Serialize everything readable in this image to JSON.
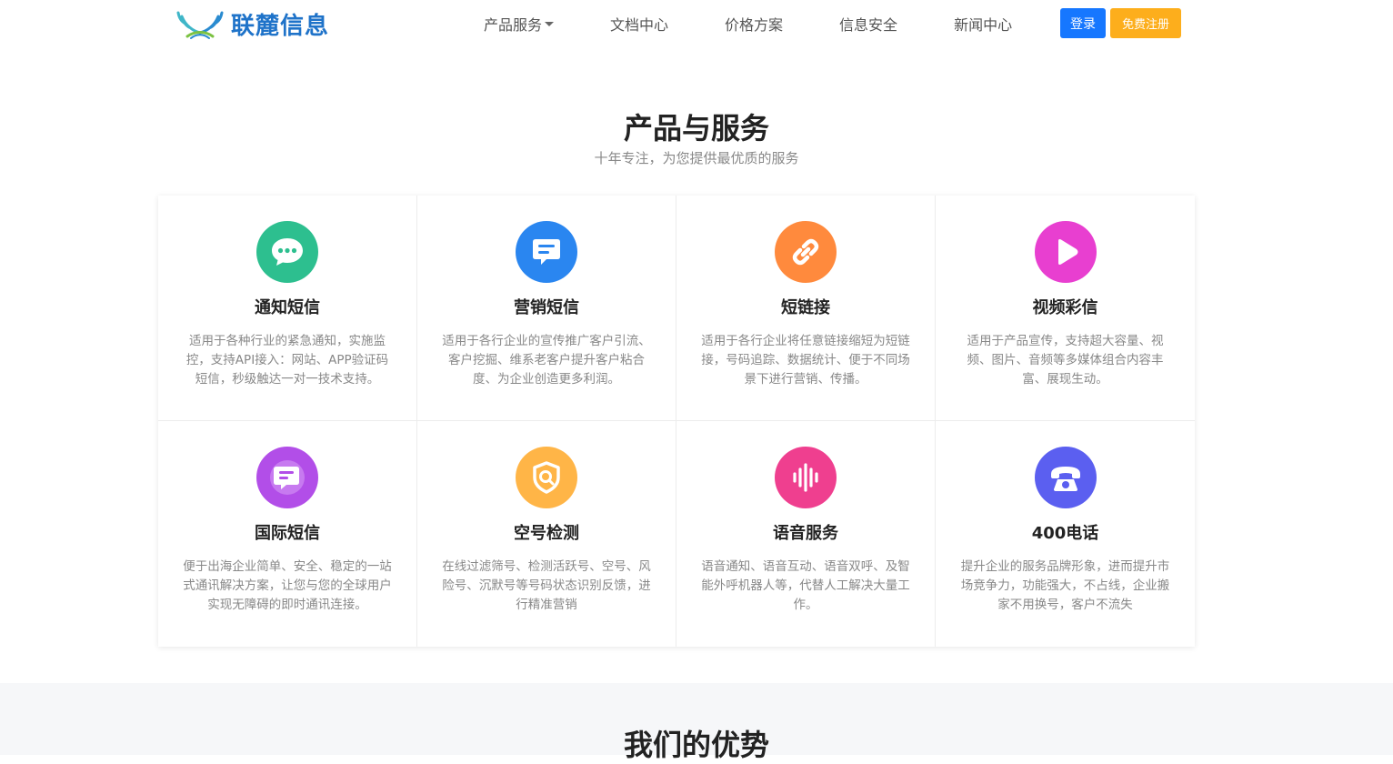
{
  "header": {
    "logo_text": "联麓信息",
    "nav": [
      {
        "label": "产品服务",
        "has_dropdown": true
      },
      {
        "label": "文档中心"
      },
      {
        "label": "价格方案"
      },
      {
        "label": "信息安全"
      },
      {
        "label": "新闻中心"
      }
    ],
    "login_label": "登录",
    "register_label": "免费注册"
  },
  "products": {
    "title": "产品与服务",
    "subtitle": "十年专注，为您提供最优质的服务",
    "items": [
      {
        "title": "通知短信",
        "desc": "适用于各种行业的紧急通知，实施监控，支持API接入：网站、APP验证码短信，秒级触达一对一技术支持。",
        "icon": "chat-bubble-icon",
        "color": "#2dbf8f"
      },
      {
        "title": "营销短信",
        "desc": "适用于各行企业的宣传推广客户引流、客户挖掘、维系老客户提升客户粘合度、为企业创造更多利润。",
        "icon": "message-icon",
        "color": "#2a86f0"
      },
      {
        "title": "短链接",
        "desc": "适用于各行企业将任意链接缩短为短链接，号码追踪、数据统计、便于不同场景下进行营销、传播。",
        "icon": "link-icon",
        "color": "#ff8a3d"
      },
      {
        "title": "视频彩信",
        "desc": "适用于产品宣传，支持超大容量、视频、图片、音频等多媒体组合内容丰富、展现生动。",
        "icon": "play-icon",
        "color": "#e83fd0"
      },
      {
        "title": "国际短信",
        "desc": "便于出海企业简单、安全、稳定的一站式通讯解决方案，让您与您的全球用户实现无障碍的即时通讯连接。",
        "icon": "globe-message-icon",
        "color": "#b24ee8"
      },
      {
        "title": "空号检测",
        "desc": "在线过滤筛号、检测活跃号、空号、风险号、沉默号等号码状态识别反馈，进行精准营销",
        "icon": "shield-search-icon",
        "color": "#ffb547"
      },
      {
        "title": "语音服务",
        "desc": "语音通知、语音互动、语音双呼、及智能外呼机器人等，代替人工解决大量工作。",
        "icon": "sound-wave-icon",
        "color": "#ef3f8f"
      },
      {
        "title": "400电话",
        "desc": "提升企业的服务品牌形象，进而提升市场竞争力，功能强大，不占线，企业搬家不用换号，客户不流失",
        "icon": "telephone-icon",
        "color": "#5b5ff0"
      }
    ]
  },
  "advantages": {
    "title": "我们的优势"
  }
}
